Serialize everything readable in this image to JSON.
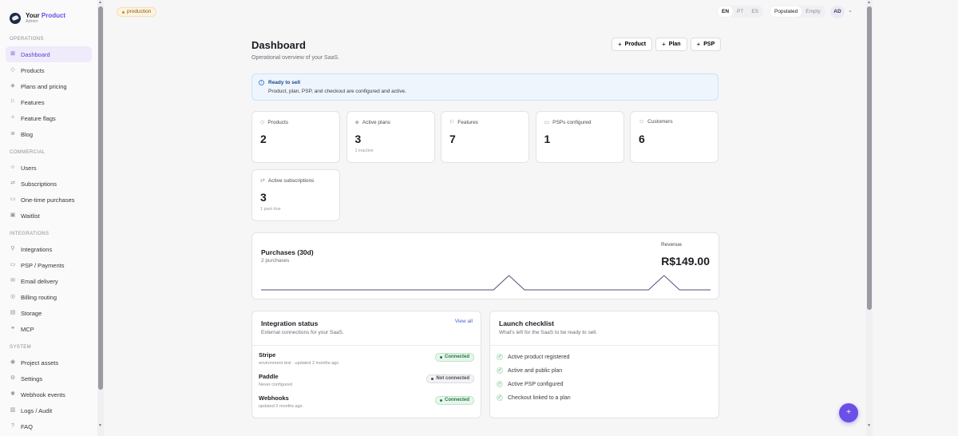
{
  "brand": {
    "name_a": "Your",
    "name_b": "Product",
    "sub": "Admin"
  },
  "sidebar": {
    "sections": [
      {
        "title": "OPERATIONS",
        "items": [
          {
            "label": "Dashboard",
            "icon": "grid-icon",
            "glyph": "⊞",
            "active": true
          },
          {
            "label": "Products",
            "icon": "box-icon",
            "glyph": "◇"
          },
          {
            "label": "Plans and pricing",
            "icon": "tag-icon",
            "glyph": "◈"
          },
          {
            "label": "Features",
            "icon": "flag-icon",
            "glyph": "⚐"
          },
          {
            "label": "Feature flags",
            "icon": "toggle-icon",
            "glyph": "✧"
          },
          {
            "label": "Blog",
            "icon": "article-icon",
            "glyph": "≣"
          }
        ]
      },
      {
        "title": "COMMERCIAL",
        "items": [
          {
            "label": "Users",
            "icon": "user-icon",
            "glyph": "☺"
          },
          {
            "label": "Subscriptions",
            "icon": "repeat-icon",
            "glyph": "⇄"
          },
          {
            "label": "One-time purchases",
            "icon": "cart-icon",
            "glyph": "▭"
          },
          {
            "label": "Waitlist",
            "icon": "inbox-icon",
            "glyph": "▣"
          }
        ]
      },
      {
        "title": "INTEGRATIONS",
        "items": [
          {
            "label": "Integrations",
            "icon": "plug-icon",
            "glyph": "⚲"
          },
          {
            "label": "PSP / Payments",
            "icon": "card-icon",
            "glyph": "▭"
          },
          {
            "label": "Email delivery",
            "icon": "mail-icon",
            "glyph": "✉"
          },
          {
            "label": "Billing routing",
            "icon": "globe-icon",
            "glyph": "◎"
          },
          {
            "label": "Storage",
            "icon": "database-icon",
            "glyph": "▤"
          },
          {
            "label": "MCP",
            "icon": "link-icon",
            "glyph": "⚭"
          }
        ]
      },
      {
        "title": "SYSTEM",
        "items": [
          {
            "label": "Project assets",
            "icon": "image-icon",
            "glyph": "◉"
          },
          {
            "label": "Settings",
            "icon": "gear-icon",
            "glyph": "⚙"
          },
          {
            "label": "Webhook events",
            "icon": "webhook-icon",
            "glyph": "✺"
          },
          {
            "label": "Logs / Audit",
            "icon": "log-icon",
            "glyph": "▥"
          },
          {
            "label": "FAQ",
            "icon": "help-icon",
            "glyph": "?"
          }
        ]
      }
    ]
  },
  "topbar": {
    "env": "production",
    "languages": [
      "EN",
      "PT",
      "ES"
    ],
    "active_language": "EN",
    "modes": [
      "Populated",
      "Empty"
    ],
    "active_mode": "Populated",
    "avatar": "AD"
  },
  "page": {
    "title": "Dashboard",
    "subtitle": "Operational overview of your SaaS."
  },
  "actions": [
    {
      "label": "Product",
      "name": "add-product-button"
    },
    {
      "label": "Plan",
      "name": "add-plan-button"
    },
    {
      "label": "PSP",
      "name": "add-psp-button"
    }
  ],
  "alert": {
    "title": "Ready to sell",
    "text": "Product, plan, PSP, and checkout are configured and active."
  },
  "stats": [
    {
      "label": "Products",
      "value": "2",
      "note": "",
      "icon": "box-icon",
      "glyph": "◇"
    },
    {
      "label": "Active plans",
      "value": "3",
      "note": "1 inactive",
      "icon": "tag-icon",
      "glyph": "◈"
    },
    {
      "label": "Features",
      "value": "7",
      "note": "",
      "icon": "flag-icon",
      "glyph": "⚐"
    },
    {
      "label": "PSPs configured",
      "value": "1",
      "note": "",
      "icon": "card-icon",
      "glyph": "▭"
    },
    {
      "label": "Customers",
      "value": "6",
      "note": "",
      "icon": "user-icon",
      "glyph": "☺"
    },
    {
      "label": "Active subscriptions",
      "value": "3",
      "note": "1 past due",
      "icon": "repeat-icon",
      "glyph": "⇄"
    }
  ],
  "purchases": {
    "title": "Purchases (30d)",
    "subtitle": "2 purchases",
    "revenue_label": "Revenue",
    "revenue_value": "R$149.00"
  },
  "chart_data": {
    "type": "line",
    "series": [
      {
        "values": [
          0,
          0,
          0,
          0,
          0,
          0,
          0,
          0,
          0,
          0,
          0,
          0,
          0,
          0,
          0,
          0,
          1,
          0,
          0,
          0,
          0,
          0,
          0,
          0,
          0,
          0,
          1,
          0,
          0,
          0
        ]
      }
    ],
    "ylim": [
      0,
      1
    ],
    "color": "#4f4f7a"
  },
  "integrations": {
    "title": "Integration status",
    "subtitle": "External connections for your SaaS.",
    "view_all": "View all",
    "rows": [
      {
        "name": "Stripe",
        "meta": "environment test · updated 2 months ago",
        "status": "Connected",
        "ok": true
      },
      {
        "name": "Paddle",
        "meta": "Never configured",
        "status": "Not connected",
        "ok": false
      },
      {
        "name": "Webhooks",
        "meta": "updated 2 months ago",
        "status": "Connected",
        "ok": true
      }
    ]
  },
  "checklist": {
    "title": "Launch checklist",
    "subtitle": "What's left for the SaaS to be ready to sell.",
    "items": [
      "Active product registered",
      "Active and public plan",
      "Active PSP configured",
      "Checkout linked to a plan"
    ]
  },
  "fab": {
    "label": "+"
  }
}
